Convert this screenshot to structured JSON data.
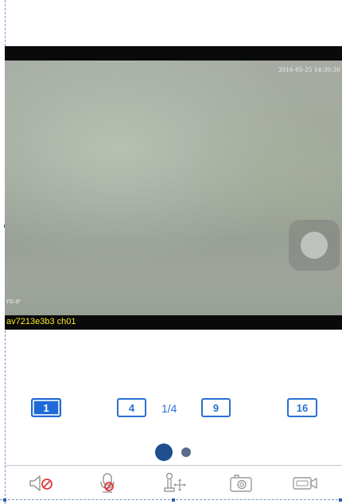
{
  "video": {
    "timestamp": "2016-05-25 14:30:30",
    "osd_label": "FD-IP",
    "channel_label": "av7213e3b3 ch01"
  },
  "split_selector": {
    "options": [
      {
        "label": "1",
        "active": true
      },
      {
        "label": "4",
        "active": false
      },
      {
        "label": "9",
        "active": false
      },
      {
        "label": "16",
        "active": false
      }
    ],
    "page_indicator": "1/4"
  },
  "pager": {
    "pages": 2,
    "current": 1
  },
  "toolbar": {
    "items": [
      {
        "icon": "speaker-muted-icon"
      },
      {
        "icon": "microphone-muted-icon"
      },
      {
        "icon": "ptz-control-icon"
      },
      {
        "icon": "snapshot-camera-icon"
      },
      {
        "icon": "record-video-icon"
      }
    ]
  },
  "colors": {
    "accent": "#2a6fd4",
    "active_fill": "#1f6ad6",
    "channel_label": "#f7e62a",
    "muted_slash": "#e0393b"
  }
}
